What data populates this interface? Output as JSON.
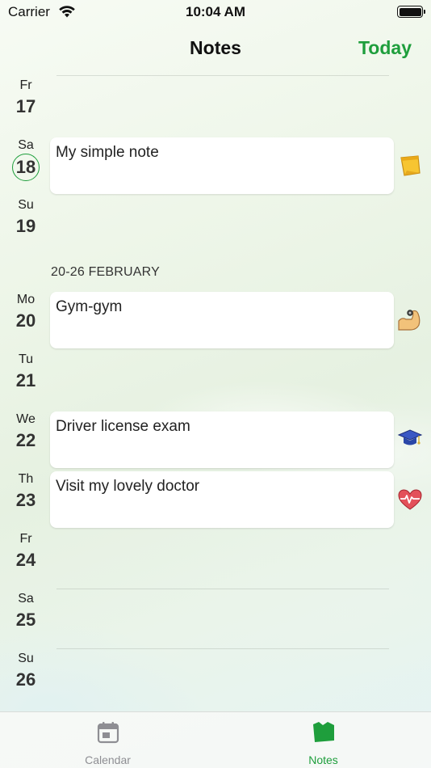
{
  "status_bar": {
    "carrier": "Carrier",
    "time": "10:04 AM"
  },
  "nav": {
    "title": "Notes",
    "today_button": "Today"
  },
  "days": [
    {
      "dow": "Fr",
      "num": "17"
    },
    {
      "dow": "Sa",
      "num": "18",
      "today": true
    },
    {
      "dow": "Su",
      "num": "19"
    },
    {
      "dow": "Mo",
      "num": "20"
    },
    {
      "dow": "Tu",
      "num": "21"
    },
    {
      "dow": "We",
      "num": "22"
    },
    {
      "dow": "Th",
      "num": "23"
    },
    {
      "dow": "Fr",
      "num": "24"
    },
    {
      "dow": "Sa",
      "num": "25"
    },
    {
      "dow": "Su",
      "num": "26"
    }
  ],
  "week_header": "20-26 FEBRUARY",
  "notes": [
    {
      "text": "My simple note",
      "icon": "sticky-note-icon"
    },
    {
      "text": "Gym-gym",
      "icon": "flexed-biceps-icon"
    },
    {
      "text": "Driver license exam",
      "icon": "graduation-cap-icon"
    },
    {
      "text": "Visit my lovely doctor",
      "icon": "heartbeat-icon"
    }
  ],
  "tabs": [
    {
      "label": "Calendar",
      "icon": "calendar-icon",
      "active": false
    },
    {
      "label": "Notes",
      "icon": "note-icon",
      "active": true
    }
  ],
  "colors": {
    "accent": "#1e9e3c",
    "inactive_tab": "#8e8e93"
  }
}
